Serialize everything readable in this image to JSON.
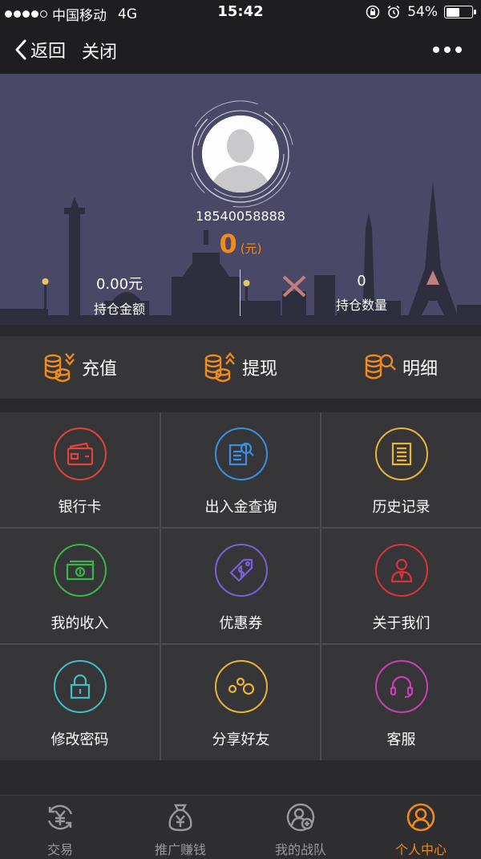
{
  "status_bar": {
    "carrier": "中国移动",
    "network": "4G",
    "time": "15:42",
    "battery": "54%",
    "battery_level": 0.54
  },
  "nav": {
    "back_label": "返回",
    "close_label": "关闭"
  },
  "profile": {
    "phone": "18540058888",
    "balance_value": "0",
    "balance_unit": "(元)",
    "position_amount_value": "0.00元",
    "position_amount_label": "持仓金额",
    "position_count_value": "0",
    "position_count_label": "持仓数量"
  },
  "actions": [
    {
      "label": "充值",
      "icon": "coins-down-icon"
    },
    {
      "label": "提现",
      "icon": "coins-up-icon"
    },
    {
      "label": "明细",
      "icon": "coins-search-icon"
    }
  ],
  "grid": [
    {
      "label": "银行卡",
      "icon": "bank-card-icon",
      "color": "#e0443c"
    },
    {
      "label": "出入金查询",
      "icon": "document-search-icon",
      "color": "#3b8fe0"
    },
    {
      "label": "历史记录",
      "icon": "history-doc-icon",
      "color": "#e8b43a"
    },
    {
      "label": "我的收入",
      "icon": "money-icon",
      "color": "#3bb54a"
    },
    {
      "label": "优惠券",
      "icon": "coupon-tag-icon",
      "color": "#7a5fd6"
    },
    {
      "label": "关于我们",
      "icon": "person-icon",
      "color": "#d8343c"
    },
    {
      "label": "修改密码",
      "icon": "lock-icon",
      "color": "#3fbfc4"
    },
    {
      "label": "分享好友",
      "icon": "share-circles-icon",
      "color": "#e8b43a"
    },
    {
      "label": "客服",
      "icon": "headset-icon",
      "color": "#c83fb6"
    }
  ],
  "tabbar": [
    {
      "label": "交易",
      "icon": "yuan-exchange-icon",
      "active": false
    },
    {
      "label": "推广赚钱",
      "icon": "money-bag-icon",
      "active": false
    },
    {
      "label": "我的战队",
      "icon": "team-add-icon",
      "active": false
    },
    {
      "label": "个人中心",
      "icon": "user-center-icon",
      "active": true
    }
  ],
  "colors": {
    "accent": "#f08a1c",
    "header_bg": "#494866",
    "panel_bg": "#363638"
  }
}
